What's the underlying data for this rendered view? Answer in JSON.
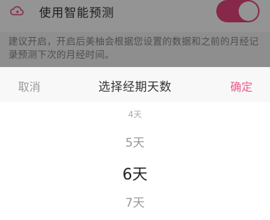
{
  "background": {
    "row_title": "使用智能预测",
    "toggle_on": true,
    "description": "建议开启，开启后美柚会根据您设置的数据和之前的月经记录预测下次的月经时间。"
  },
  "picker": {
    "cancel_label": "取消",
    "title": "选择经期天数",
    "confirm_label": "确定",
    "options": [
      "4天",
      "5天",
      "6天",
      "7天"
    ],
    "selected": "6天"
  },
  "colors": {
    "accent": "#ee5a8f",
    "overlay": "rgba(0,0,0,0.42)"
  }
}
